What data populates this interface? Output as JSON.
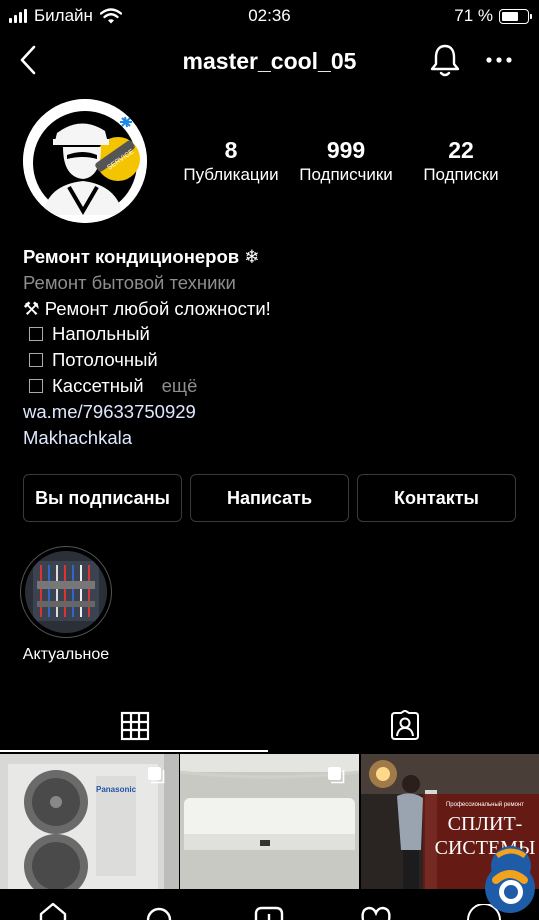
{
  "status_bar": {
    "carrier": "Билайн",
    "time": "02:36",
    "battery": "71 %",
    "battery_level": 0.71
  },
  "header": {
    "username": "master_cool_05"
  },
  "profile": {
    "stats": [
      {
        "value": "8",
        "label": "Публикации"
      },
      {
        "value": "999",
        "label": "Подписчики"
      },
      {
        "value": "22",
        "label": "Подписки"
      }
    ],
    "bio": {
      "name": "Ремонт кондиционеров",
      "name_emoji": "❄",
      "category": "Ремонт бытовой техники",
      "line1_emoji": "⚒",
      "line1": "Ремонт любой сложности!",
      "items": [
        "Напольный",
        "Потолочный",
        "Кассетный"
      ],
      "more": "ещё",
      "link": "wa.me/79633750929",
      "location": "Makhachkala"
    }
  },
  "actions": {
    "following": "Вы подписаны",
    "message": "Написать",
    "contacts": "Контакты"
  },
  "highlight": {
    "label": "Актуальное"
  },
  "posts": [
    {
      "text": "Panasonic"
    },
    {
      "text": ""
    },
    {
      "small": "Профессиональный ремонт",
      "title1": "СПЛИТ-",
      "title2": "СИСТЕМЫ"
    }
  ],
  "icons": [
    "chevron-left-icon",
    "bell-icon",
    "more-icon",
    "grid-icon",
    "tagged-icon",
    "multiple-posts-icon",
    "home-icon",
    "search-icon",
    "new-post-icon",
    "heart-icon"
  ],
  "colors": {
    "background": "#000000",
    "text": "#ffffff",
    "muted": "#8e8e8e",
    "border": "#3a3a3a"
  }
}
